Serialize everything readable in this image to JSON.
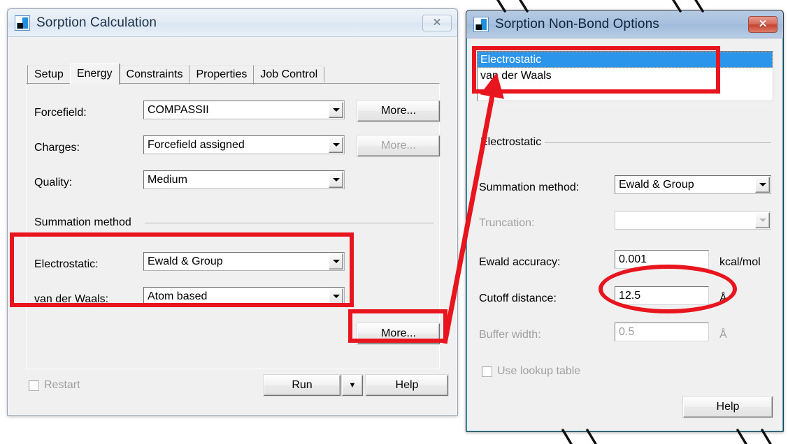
{
  "left_dialog": {
    "title": "Sorption Calculation",
    "close_label": "✕",
    "tabs": [
      {
        "label": "Setup",
        "selected": false
      },
      {
        "label": "Energy",
        "selected": true
      },
      {
        "label": "Constraints",
        "selected": false
      },
      {
        "label": "Properties",
        "selected": false
      },
      {
        "label": "Job Control",
        "selected": false
      }
    ],
    "fields": {
      "forcefield_label": "Forcefield:",
      "forcefield_value": "COMPASSII",
      "forcefield_more": "More...",
      "charges_label": "Charges:",
      "charges_value": "Forcefield assigned",
      "charges_more": "More...",
      "quality_label": "Quality:",
      "quality_value": "Medium"
    },
    "summation_group": {
      "title": "Summation method",
      "electrostatic_label": "Electrostatic:",
      "electrostatic_value": "Ewald & Group",
      "vdw_label": "van der Waals:",
      "vdw_value": "Atom based",
      "more_label": "More..."
    },
    "footer": {
      "restart_label": "Restart",
      "run_label": "Run",
      "run_caret": "▼",
      "help_label": "Help"
    }
  },
  "right_dialog": {
    "title": "Sorption Non-Bond Options",
    "close_label": "✕",
    "list_items": [
      {
        "label": "Electrostatic",
        "selected": true
      },
      {
        "label": "van der Waals",
        "selected": false
      }
    ],
    "group_title": "Electrostatic",
    "rows": {
      "summation_label": "Summation method:",
      "summation_value": "Ewald & Group",
      "truncation_label": "Truncation:",
      "truncation_value": "",
      "ewald_accuracy_label": "Ewald accuracy:",
      "ewald_accuracy_value": "0.001",
      "ewald_accuracy_unit": "kcal/mol",
      "cutoff_label": "Cutoff distance:",
      "cutoff_value": "12.5",
      "cutoff_unit": "Å",
      "buffer_label": "Buffer width:",
      "buffer_value": "0.5",
      "buffer_unit": "Å",
      "lookup_label": "Use lookup table"
    },
    "help_label": "Help"
  },
  "annotations": {
    "accent_color": "#e8141e",
    "highlight_boxes": [
      "summation-method-rows",
      "more-button",
      "non-bond-list"
    ],
    "highlight_ellipse": "cutoff-distance-value",
    "arrow": "more-button-to-list"
  }
}
